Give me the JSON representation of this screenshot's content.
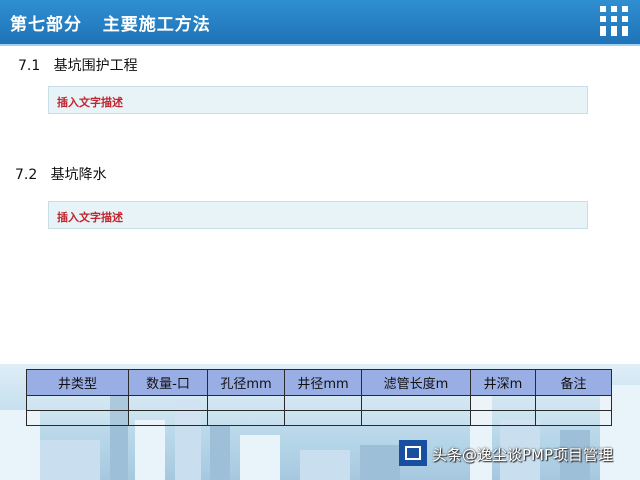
{
  "header": {
    "title": "第七部分   主要施工方法",
    "logo_icon": "grid-logo-icon"
  },
  "sections": [
    {
      "number": "7.1",
      "title": "基坑围护工程",
      "description": "插入文字描述"
    },
    {
      "number": "7.2",
      "title": "基坑降水",
      "description": "插入文字描述"
    }
  ],
  "table": {
    "headers": [
      "井类型",
      "数量-口",
      "孔径mm",
      "井径mm",
      "滤管长度m",
      "井深m",
      "备注"
    ],
    "rows": [
      [
        "",
        "",
        "",
        "",
        "",
        "",
        ""
      ],
      [
        "",
        "",
        "",
        "",
        "",
        "",
        ""
      ]
    ]
  },
  "footer": {
    "watermark": "头条@逸尘谈PMP项目管理",
    "logo_icon": "cscec-logo-icon"
  },
  "colors": {
    "header_bg": "#1f73b8",
    "description_text": "#c0262e",
    "table_header_bg": "#9aaee6"
  }
}
